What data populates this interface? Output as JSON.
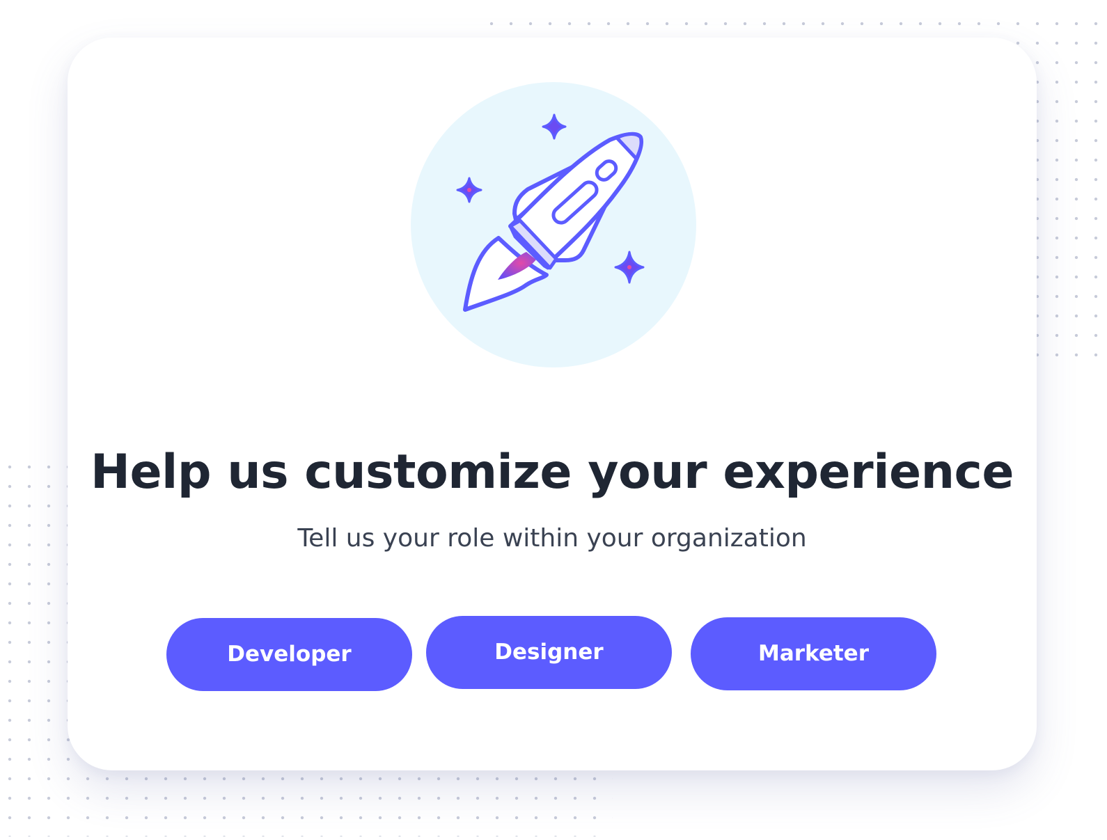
{
  "onboarding": {
    "title": "Help us customize your experience",
    "subtitle": "Tell us your role within your organization",
    "roles": [
      {
        "label": "Developer"
      },
      {
        "label": "Designer"
      },
      {
        "label": "Marketer"
      }
    ]
  },
  "illustration": {
    "icon": "rocket-icon",
    "decorations": [
      "sparkle-icon",
      "sparkle-icon",
      "sparkle-icon"
    ]
  },
  "colors": {
    "accent": "#5c5cff",
    "illustration_circle": "#e8f7fd",
    "title": "#1f2633",
    "subtitle": "#3a4252",
    "button_text": "#ffffff"
  }
}
